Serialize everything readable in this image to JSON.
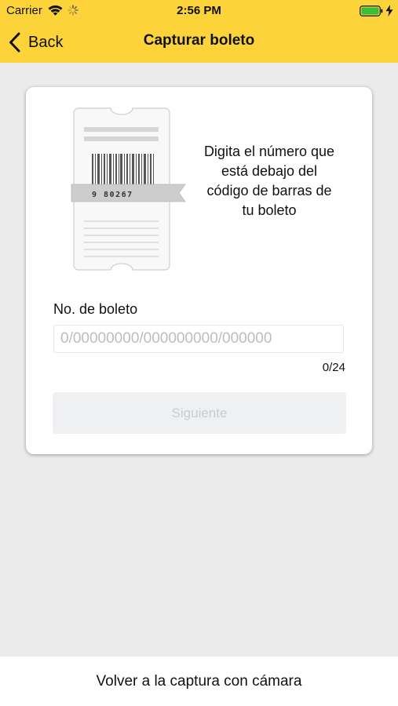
{
  "status_bar": {
    "carrier": "Carrier",
    "time": "2:56 PM",
    "icons": [
      "wifi-icon",
      "activity-spinner-icon",
      "battery-icon",
      "charging-bolt-icon"
    ]
  },
  "nav": {
    "back_label": "Back",
    "title": "Capturar boleto",
    "accent_color": "#fdd33a"
  },
  "card": {
    "illustration_number": "9 80267",
    "instructions": "Digita el número que está debajo del código de barras de tu boleto",
    "field_label": "No. de boleto",
    "field_value": "",
    "field_placeholder": "0/00000000/000000000/000000",
    "char_counter": "0/24",
    "next_label": "Siguiente"
  },
  "footer": {
    "camera_link": "Volver a la captura con cámara"
  }
}
